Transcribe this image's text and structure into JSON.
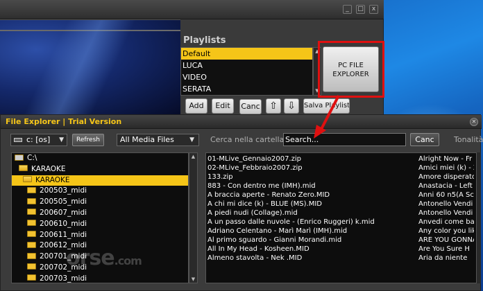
{
  "window": {
    "min": "_",
    "max": "□",
    "close": "x"
  },
  "playlists": {
    "title": "Playlists",
    "items": [
      "Default",
      "LUCA",
      "VIDEO",
      "SERATA"
    ],
    "selected": 0
  },
  "buttons": {
    "add": "Add",
    "edit": "Edit",
    "canc": "Canc",
    "up": "⇧",
    "down": "⇩",
    "save": "Salva Playlist"
  },
  "pc_file_explorer": "PC FILE\nEXPLORER",
  "file_explorer": {
    "title": "File Explorer | Trial Version",
    "drive": "c: [os]",
    "refresh": "Refresh",
    "filter": "All Media Files",
    "search_label": "Cerca nella cartella",
    "search_value": "Search...",
    "search_clear": "Canc",
    "tonality_label": "Tonalità",
    "tree": [
      {
        "label": "C:\\",
        "indent": 0,
        "open": true
      },
      {
        "label": "KARAOKE",
        "indent": 1,
        "open": true
      },
      {
        "label": "KARAOKE",
        "indent": 2,
        "open": true,
        "selected": true
      },
      {
        "label": "200503_midi",
        "indent": 3
      },
      {
        "label": "200505_midi",
        "indent": 3
      },
      {
        "label": "200607_midi",
        "indent": 3
      },
      {
        "label": "200610_midi",
        "indent": 3
      },
      {
        "label": "200611_midi",
        "indent": 3
      },
      {
        "label": "200612_midi",
        "indent": 3
      },
      {
        "label": "200701_midi",
        "indent": 3
      },
      {
        "label": "200702_midi",
        "indent": 3
      },
      {
        "label": "200703_midi",
        "indent": 3
      }
    ],
    "files": [
      {
        "name": "01-MLive_Gennaio2007.zip",
        "title": "Alright Now - Fr"
      },
      {
        "name": "02-MLive_Febbraio2007.zip",
        "title": "Amici miei (k) - Z"
      },
      {
        "name": "133.zip",
        "title": "Amore disperato"
      },
      {
        "name": "883 - Con dentro me (IMH).mid",
        "title": "Anastacia - Left"
      },
      {
        "name": "A braccia aperte - Renato Zero.MID",
        "title": "Anni 60 n5(A Sc"
      },
      {
        "name": "A chi mi dice (k) - BLUE (MS).MID",
        "title": "Antonello Vendi"
      },
      {
        "name": "A piedi nudi (Collage).mid",
        "title": "Antonello Vendi"
      },
      {
        "name": "A un passo dalle nuvole - (Enrico Ruggeri)  k.mid",
        "title": "Anvedi come ba"
      },
      {
        "name": "Adriano Celentano - Marì Marì (IMH).mid",
        "title": "Any color you lik"
      },
      {
        "name": "Al primo sguardo  - Gianni Morandi.mid",
        "title": "ARE YOU GONNA"
      },
      {
        "name": "All In My Head - Kosheen.MID",
        "title": "Are You Sure H"
      },
      {
        "name": "Almeno stavolta - Nek .MID",
        "title": "Aria da niente"
      }
    ]
  },
  "watermark": {
    "text": "orse",
    "suffix": ".com"
  },
  "colors": {
    "accent": "#f5c518",
    "highlight_box": "#e01010"
  }
}
